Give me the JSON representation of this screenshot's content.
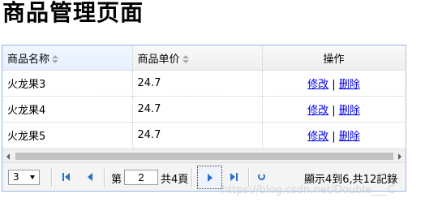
{
  "page": {
    "title": "商品管理页面"
  },
  "table": {
    "columns": [
      "商品名称",
      "商品单价",
      "操作"
    ],
    "rows": [
      {
        "name": "火龙果3",
        "price": "24.7",
        "edit": "修改",
        "sep": "|",
        "delete": "删除"
      },
      {
        "name": "火龙果4",
        "price": "24.7",
        "edit": "修改",
        "sep": "|",
        "delete": "删除"
      },
      {
        "name": "火龙果5",
        "price": "24.7",
        "edit": "修改",
        "sep": "|",
        "delete": "删除"
      }
    ]
  },
  "pager": {
    "page_size": "3",
    "page_prefix": "第",
    "current_page": "2",
    "page_suffix": "共4頁",
    "summary": "顯示4到6,共12記錄"
  },
  "watermark": "https://blog.csdn.net/Double___C",
  "colors": {
    "link": "#0000ee",
    "accent": "#2a6fc9",
    "border": "#95b8e7"
  }
}
